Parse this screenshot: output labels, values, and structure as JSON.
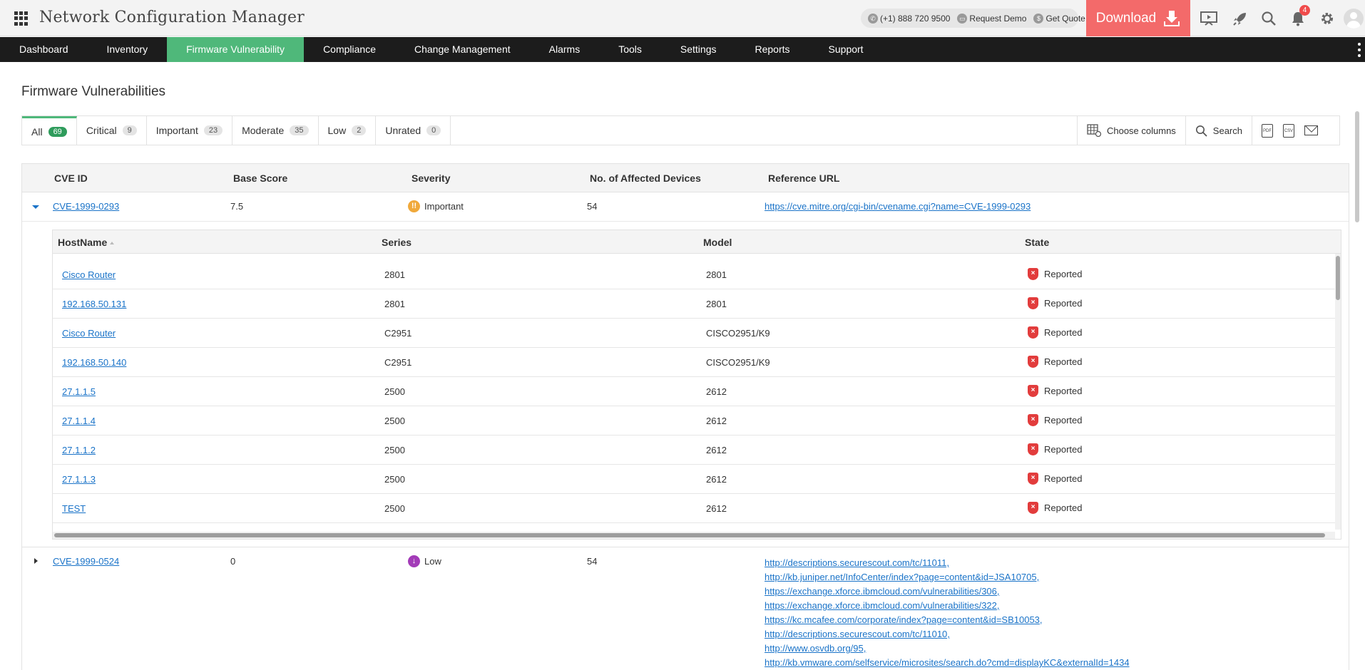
{
  "app": {
    "title": "Network Configuration Manager",
    "phone": "(+1) 888 720 9500",
    "request_demo": "Request Demo",
    "get_quote": "Get Quote",
    "download_label": "Download",
    "notification_count": "4"
  },
  "nav": [
    {
      "label": "Dashboard",
      "active": false
    },
    {
      "label": "Inventory",
      "active": false
    },
    {
      "label": "Firmware Vulnerability",
      "active": true
    },
    {
      "label": "Compliance",
      "active": false
    },
    {
      "label": "Change Management",
      "active": false
    },
    {
      "label": "Alarms",
      "active": false
    },
    {
      "label": "Tools",
      "active": false
    },
    {
      "label": "Settings",
      "active": false
    },
    {
      "label": "Reports",
      "active": false
    },
    {
      "label": "Support",
      "active": false
    }
  ],
  "page_title": "Firmware Vulnerabilities",
  "tabs": [
    {
      "label": "All",
      "count": "69"
    },
    {
      "label": "Critical",
      "count": "9"
    },
    {
      "label": "Important",
      "count": "23"
    },
    {
      "label": "Moderate",
      "count": "35"
    },
    {
      "label": "Low",
      "count": "2"
    },
    {
      "label": "Unrated",
      "count": "0"
    }
  ],
  "toolbar": {
    "choose_columns": "Choose columns",
    "search": "Search"
  },
  "table": {
    "headers": [
      "CVE ID",
      "Base Score",
      "Severity",
      "No. of Affected Devices",
      "Reference URL"
    ],
    "rows": [
      {
        "cve_id": "CVE-1999-0293",
        "base_score": "7.5",
        "severity": "Important",
        "affected": "54",
        "refs": [
          "https://cve.mitre.org/cgi-bin/cvename.cgi?name=CVE-1999-0293"
        ]
      },
      {
        "cve_id": "CVE-1999-0524",
        "base_score": "0",
        "severity": "Low",
        "affected": "54",
        "refs": [
          "http://descriptions.securescout.com/tc/11011,",
          "http://kb.juniper.net/InfoCenter/index?page=content&id=JSA10705,",
          "https://exchange.xforce.ibmcloud.com/vulnerabilities/306,",
          "https://exchange.xforce.ibmcloud.com/vulnerabilities/322,",
          "https://kc.mcafee.com/corporate/index?page=content&id=SB10053,",
          "http://descriptions.securescout.com/tc/11010,",
          "http://www.osvdb.org/95,",
          "http://kb.vmware.com/selfservice/microsites/search.do?cmd=displayKC&externalId=1434"
        ]
      }
    ]
  },
  "devices": {
    "headers": [
      "HostName",
      "Series",
      "Model",
      "State"
    ],
    "rows": [
      {
        "host": "Cisco Router",
        "series": "2801",
        "model": "2801",
        "state": "Reported"
      },
      {
        "host": "192.168.50.131",
        "series": "2801",
        "model": "2801",
        "state": "Reported"
      },
      {
        "host": "Cisco Router",
        "series": "C2951",
        "model": "CISCO2951/K9",
        "state": "Reported"
      },
      {
        "host": "192.168.50.140",
        "series": "C2951",
        "model": "CISCO2951/K9",
        "state": "Reported"
      },
      {
        "host": "27.1.1.5",
        "series": "2500",
        "model": "2612",
        "state": "Reported"
      },
      {
        "host": "27.1.1.4",
        "series": "2500",
        "model": "2612",
        "state": "Reported"
      },
      {
        "host": "27.1.1.2",
        "series": "2500",
        "model": "2612",
        "state": "Reported"
      },
      {
        "host": "27.1.1.3",
        "series": "2500",
        "model": "2612",
        "state": "Reported"
      },
      {
        "host": "TEST",
        "series": "2500",
        "model": "2612",
        "state": "Reported"
      }
    ]
  },
  "colors": {
    "accent": "#4fb87a",
    "download": "#f36a6a",
    "important": "#f0a93b",
    "low": "#a33bb8",
    "reported": "#e23c3c"
  }
}
